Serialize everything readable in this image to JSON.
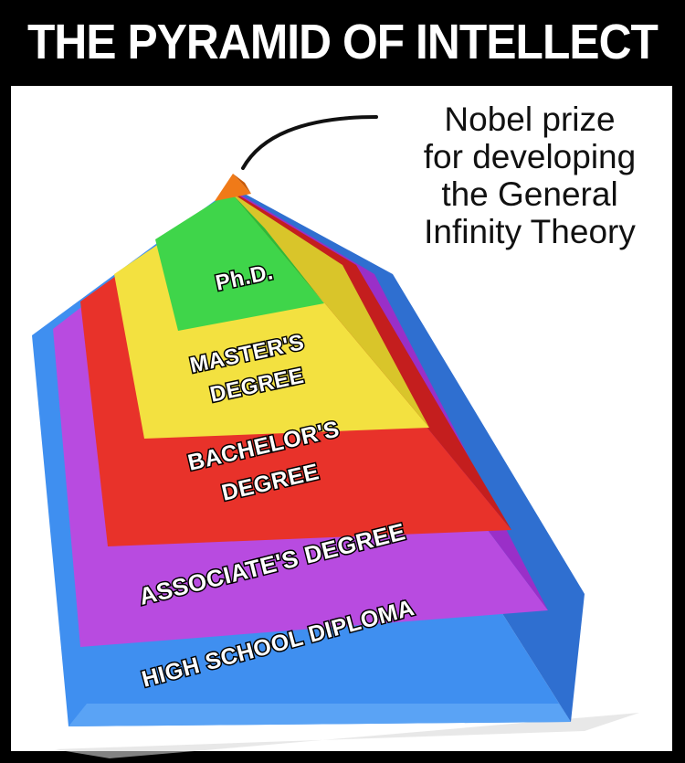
{
  "title": "THE PYRAMID OF INTELLECT",
  "annotation": {
    "lines": [
      "Nobel prize",
      "for developing",
      "the General",
      "Infinity Theory"
    ]
  },
  "levels": {
    "phd": "Ph.D.",
    "masters_1": "MASTER'S",
    "masters_2": "DEGREE",
    "bachelors_1": "BACHELOR'S",
    "bachelors_2": "DEGREE",
    "associates": "ASSOCIATE'S DEGREE",
    "high_school": "HIGH SCHOOL DIPLOMA"
  },
  "colors": {
    "blue": "#3f8ff0",
    "purple": "#b84be0",
    "red": "#e8322a",
    "yellow": "#f3e140",
    "green": "#3fd54a",
    "orange": "#f07a18"
  }
}
